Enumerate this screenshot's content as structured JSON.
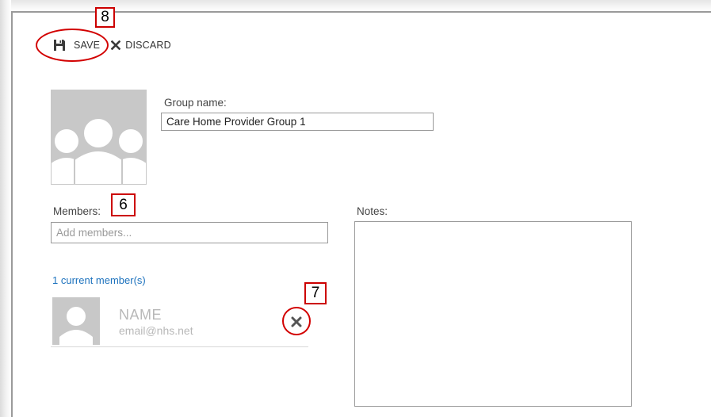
{
  "toolbar": {
    "save_label": "SAVE",
    "discard_label": "DISCARD"
  },
  "group": {
    "name_label": "Group name:",
    "name_value": "Care Home Provider Group 1"
  },
  "members": {
    "label": "Members:",
    "add_placeholder": "Add members...",
    "count_text": "1 current member(s)",
    "items": [
      {
        "name": "NAME",
        "email": "email@nhs.net"
      }
    ]
  },
  "notes": {
    "label": "Notes:",
    "value": ""
  },
  "annotations": {
    "callout_save": "8",
    "callout_members": "6",
    "callout_remove": "7",
    "highlight_color": "#d20000"
  },
  "icons": {
    "save": "save-icon",
    "discard": "close-icon",
    "group_avatar": "group-avatar-icon",
    "member_avatar": "person-icon",
    "remove": "remove-x-icon"
  }
}
